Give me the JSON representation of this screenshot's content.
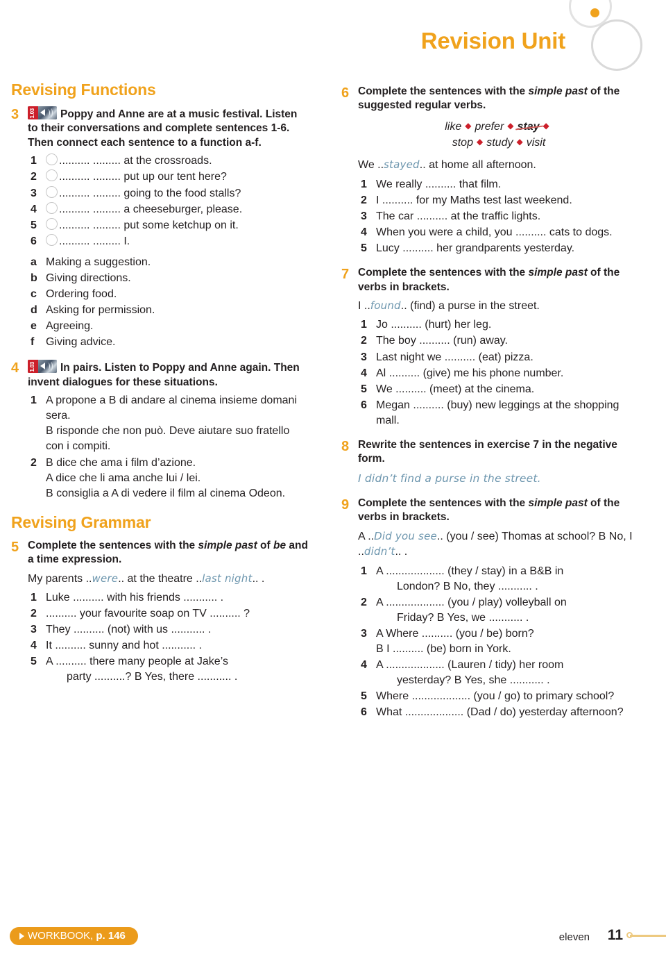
{
  "header": {
    "title": "Revision Unit"
  },
  "left_column": {
    "section_title": "Revising Functions",
    "exercise3": {
      "number": "3",
      "audio_track": "1.03",
      "instruction": "Poppy and Anne are at a music festival. Listen to their conversations and complete sentences 1-6. Then connect each sentence to a function a-f.",
      "sentences": [
        {
          "num": "1",
          "text": "..........   ......... at the crossroads."
        },
        {
          "num": "2",
          "text": "..........   ......... put up our tent here?"
        },
        {
          "num": "3",
          "text": "..........   ......... going to the food stalls?"
        },
        {
          "num": "4",
          "text": "..........   ......... a cheeseburger, please."
        },
        {
          "num": "5",
          "text": "..........   ......... put some ketchup on it."
        },
        {
          "num": "6",
          "text": "..........   ......... I."
        }
      ],
      "functions": [
        {
          "letter": "a",
          "text": "Making a suggestion."
        },
        {
          "letter": "b",
          "text": "Giving directions."
        },
        {
          "letter": "c",
          "text": "Ordering food."
        },
        {
          "letter": "d",
          "text": "Asking for permission."
        },
        {
          "letter": "e",
          "text": "Agreeing."
        },
        {
          "letter": "f",
          "text": "Giving advice."
        }
      ]
    },
    "exercise4": {
      "number": "4",
      "audio_track": "1.03",
      "instruction": "In pairs. Listen to Poppy and Anne again. Then invent dialogues for these situations.",
      "situations": [
        {
          "num": "1",
          "lines": [
            "A propone a B di andare al cinema insieme domani sera.",
            "B risponde che non può. Deve aiutare suo fratello con i compiti."
          ]
        },
        {
          "num": "2",
          "lines": [
            "B dice che ama i film d’azione.",
            "A dice che li ama anche lui / lei.",
            "B consiglia a A di vedere il film al cinema Odeon."
          ]
        }
      ]
    },
    "grammar_title": "Revising Grammar",
    "exercise5": {
      "number": "5",
      "instruction_parts": [
        "Complete the sentences with the ",
        "simple past",
        " of ",
        "be",
        " and a time expression."
      ],
      "example_pre": "My parents ..",
      "example_answer1": "were",
      "example_mid": ".. at the theatre ..",
      "example_answer2": "last night",
      "example_post": ".. .",
      "items": [
        {
          "num": "1",
          "text": "Luke .......... with his friends ........... ."
        },
        {
          "num": "2",
          "text": ".......... your favourite soap on TV .......... ?"
        },
        {
          "num": "3",
          "text": "They .......... (not) with us ........... ."
        },
        {
          "num": "4",
          "text": "It .......... sunny and hot ........... ."
        },
        {
          "num": "5",
          "text": "A .......... there many people at Jake’s",
          "text2": "party ..........?   B  Yes, there ........... ."
        }
      ]
    }
  },
  "right_column": {
    "exercise6": {
      "number": "6",
      "instruction_parts": [
        "Complete the sentences with the ",
        "simple past",
        " of the suggested regular verbs."
      ],
      "wordbank_line1": [
        "like",
        "prefer",
        "stay"
      ],
      "wordbank_line2": [
        "stop",
        "study",
        "visit"
      ],
      "wordbank_struck": "stay",
      "example_pre": "We ..",
      "example_answer": "stayed",
      "example_post": ".. at home all afternoon.",
      "items": [
        {
          "num": "1",
          "text": "We really .......... that film."
        },
        {
          "num": "2",
          "text": "I .......... for my Maths test last weekend."
        },
        {
          "num": "3",
          "text": "The car .......... at the traffic lights."
        },
        {
          "num": "4",
          "text": "When you were a child, you .......... cats to dogs."
        },
        {
          "num": "5",
          "text": "Lucy .......... her grandparents yesterday."
        }
      ]
    },
    "exercise7": {
      "number": "7",
      "instruction_parts": [
        "Complete the sentences with the ",
        "simple past",
        " of the verbs in brackets."
      ],
      "example_pre": "I ..",
      "example_answer": "found",
      "example_post": ".. (find) a purse in the street.",
      "items": [
        {
          "num": "1",
          "text": "Jo .......... (hurt) her leg."
        },
        {
          "num": "2",
          "text": "The boy .......... (run) away."
        },
        {
          "num": "3",
          "text": "Last night we .......... (eat) pizza."
        },
        {
          "num": "4",
          "text": "Al .......... (give) me his phone number."
        },
        {
          "num": "5",
          "text": "We .......... (meet) at the cinema."
        },
        {
          "num": "6",
          "text": "Megan .......... (buy) new leggings at the shopping mall."
        }
      ]
    },
    "exercise8": {
      "number": "8",
      "instruction": "Rewrite the sentences in exercise 7 in the negative form.",
      "example_answer": "I didn’t find a purse in the street."
    },
    "exercise9": {
      "number": "9",
      "instruction_parts": [
        "Complete the sentences with the ",
        "simple past",
        " of the verbs in brackets."
      ],
      "example_pre": "A ..",
      "example_answer1": "Did you see",
      "example_mid": ".. (you / see) Thomas at school?   B  No, I ..",
      "example_answer2": "didn’t",
      "example_post": ".. .",
      "items": [
        {
          "num": "1",
          "text": "A ................... (they / stay) in a B&B in",
          "text2": "London?    B  No, they ........... ."
        },
        {
          "num": "2",
          "text": "A ................... (you / play) volleyball on",
          "text2": "Friday?    B  Yes, we ........... ."
        },
        {
          "num": "3",
          "text": "A Where .......... (you / be) born?",
          "text2": "B I .......... (be) born in York."
        },
        {
          "num": "4",
          "text": "A ................... (Lauren / tidy) her room",
          "text2": "yesterday?   B  Yes, she ........... ."
        },
        {
          "num": "5",
          "text": "Where ................... (you / go) to primary school?"
        },
        {
          "num": "6",
          "text": "What ................... (Dad / do) yesterday afternoon?"
        }
      ]
    }
  },
  "footer": {
    "workbook_label": "WORKBOOK,",
    "workbook_page": "p. 146",
    "page_word": "eleven",
    "page_number": "11"
  }
}
